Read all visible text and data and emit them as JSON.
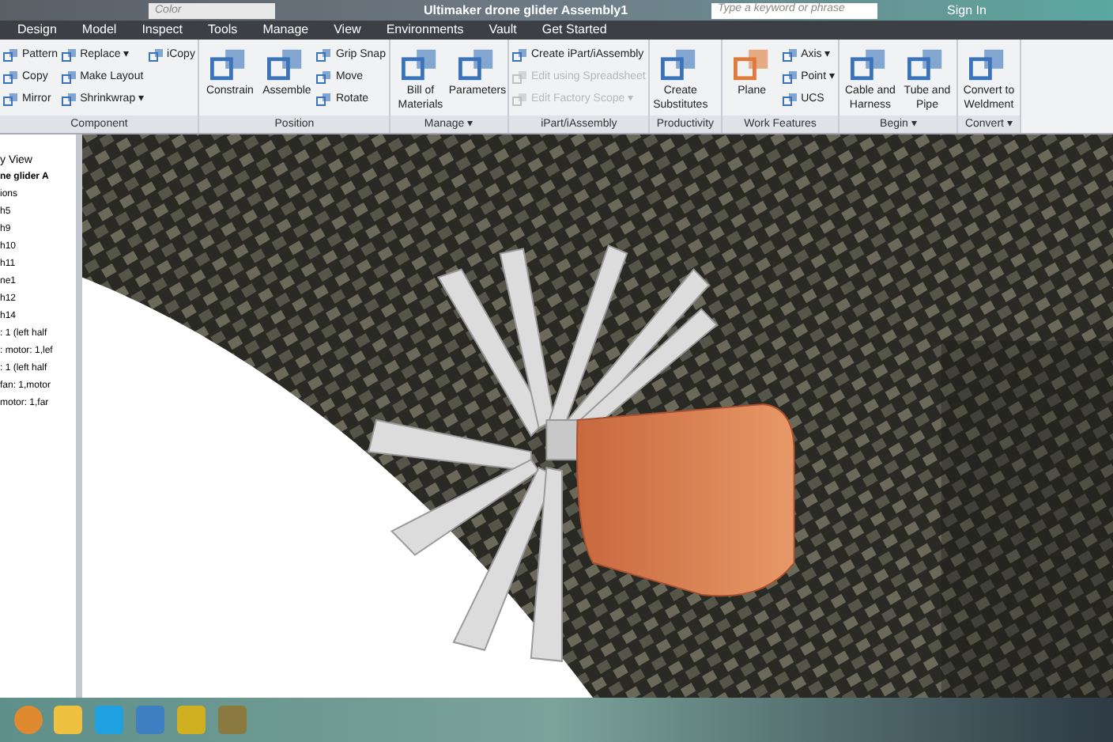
{
  "title_bar": {
    "style_box": "Color",
    "title": "Ultimaker drone glider Assembly1",
    "search": {
      "placeholder": "Type a keyword or phrase"
    },
    "sign_in": "Sign In"
  },
  "tabs": [
    {
      "label": "Design",
      "selected": false
    },
    {
      "label": "Model",
      "selected": false
    },
    {
      "label": "Inspect",
      "selected": false
    },
    {
      "label": "Tools",
      "selected": false
    },
    {
      "label": "Manage",
      "selected": false
    },
    {
      "label": "View",
      "selected": false
    },
    {
      "label": "Environments",
      "selected": false
    },
    {
      "label": "Vault",
      "selected": false
    },
    {
      "label": "Get Started",
      "selected": false
    }
  ],
  "ribbon": [
    {
      "name": "Component",
      "small": [
        {
          "label": "Pattern",
          "disabled": false
        },
        {
          "label": "Copy",
          "disabled": false
        },
        {
          "label": "Mirror",
          "disabled": false
        },
        {
          "label": "Replace ▾",
          "disabled": false
        },
        {
          "label": "Make Layout",
          "disabled": false
        },
        {
          "label": "Shrinkwrap ▾",
          "disabled": false
        },
        {
          "label": "iCopy",
          "disabled": false
        }
      ]
    },
    {
      "name": "Position",
      "large": [
        "Constrain",
        "Assemble"
      ],
      "small": [
        {
          "label": "Grip Snap",
          "disabled": false
        },
        {
          "label": "Move",
          "disabled": false
        },
        {
          "label": "Rotate",
          "disabled": false
        }
      ]
    },
    {
      "name": "Manage ▾",
      "large": [
        "Bill of Materials",
        "Parameters"
      ]
    },
    {
      "name": "iPart/iAssembly",
      "small": [
        {
          "label": "Create iPart/iAssembly",
          "disabled": false
        },
        {
          "label": "Edit using Spreadsheet",
          "disabled": true
        },
        {
          "label": "Edit Factory Scope ▾",
          "disabled": true
        }
      ]
    },
    {
      "name": "Productivity",
      "large": [
        "Create Substitutes"
      ]
    },
    {
      "name": "Work Features",
      "large": [
        "Plane"
      ],
      "small": [
        {
          "label": "Axis ▾",
          "disabled": false
        },
        {
          "label": "Point ▾",
          "disabled": false
        },
        {
          "label": "UCS",
          "disabled": false
        }
      ]
    },
    {
      "name": "Begin ▾",
      "large": [
        "Cable and Harness",
        "Tube and Pipe"
      ]
    },
    {
      "name": "Convert ▾",
      "large": [
        "Convert to Weldment"
      ]
    }
  ],
  "browser": {
    "view": "y View",
    "items": [
      "ne glider A",
      "ions",
      "h5",
      "h9",
      "h10",
      "h11",
      "ne1",
      "h12",
      "h14",
      ": 1 (left half",
      ": motor: 1,lef",
      ": 1 (left half",
      "fan: 1,motor",
      "motor: 1,far"
    ]
  }
}
